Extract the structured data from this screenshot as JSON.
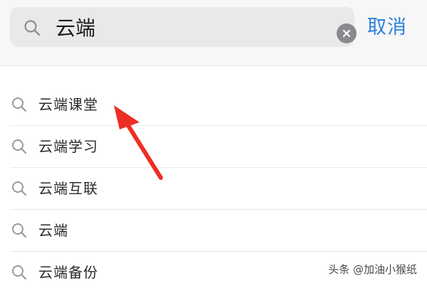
{
  "search": {
    "query": "云端",
    "cancel_label": "取消"
  },
  "suggestions": [
    {
      "label": "云端课堂"
    },
    {
      "label": "云端学习"
    },
    {
      "label": "云端互联"
    },
    {
      "label": "云端"
    },
    {
      "label": "云端备份"
    }
  ],
  "watermark": "头条 @加油小猴纸",
  "icons": {
    "search": "search-icon",
    "clear": "clear-icon",
    "suggestion": "search-icon",
    "annotation": "red-arrow"
  },
  "colors": {
    "accent": "#2c7fdc",
    "header_bg": "#f7f7f7",
    "search_field_bg": "#e9e9ea",
    "clear_button": "#8a8a8e",
    "arrow": "#ee2e24"
  }
}
